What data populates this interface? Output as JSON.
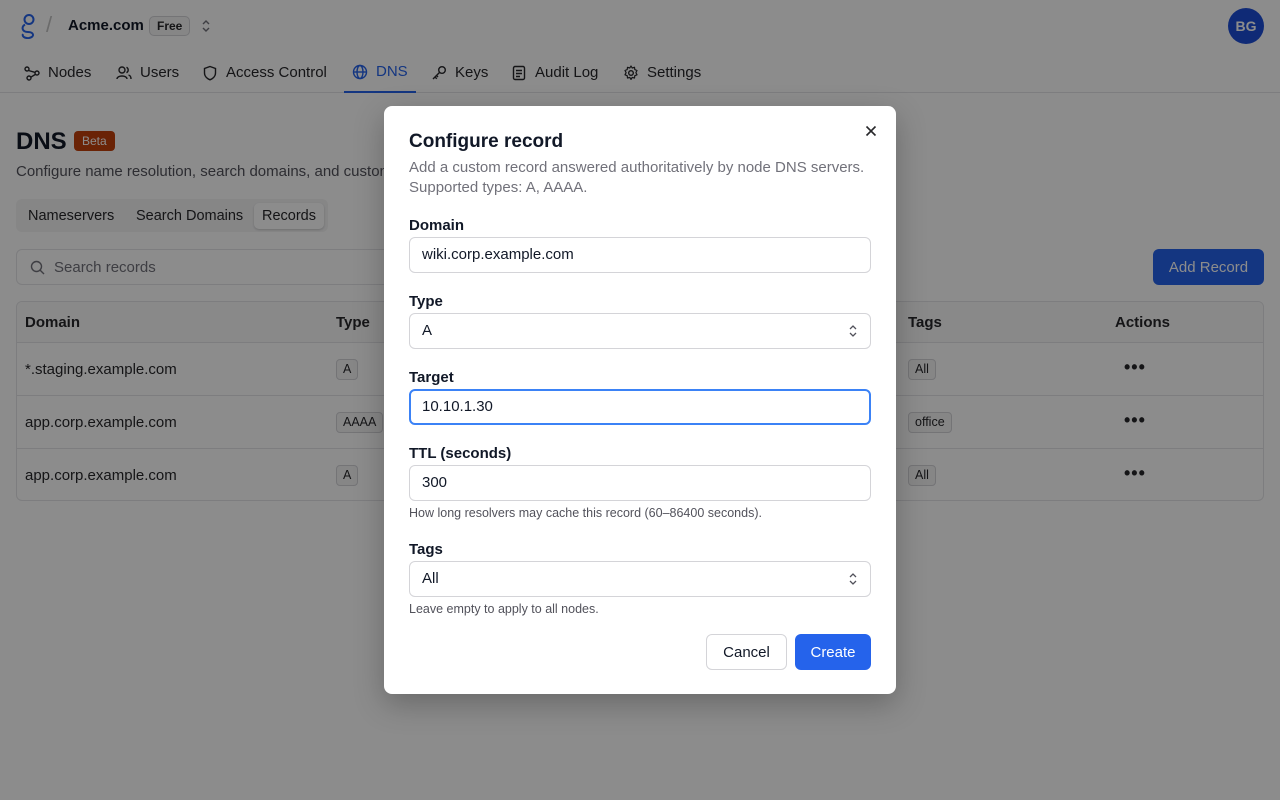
{
  "header": {
    "org_name": "Acme.com",
    "plan": "Free",
    "avatar_initials": "BG",
    "separator": "/"
  },
  "nav": {
    "items": [
      {
        "label": "Nodes",
        "icon": "nodes-icon"
      },
      {
        "label": "Users",
        "icon": "users-icon"
      },
      {
        "label": "Access Control",
        "icon": "shield-icon"
      },
      {
        "label": "DNS",
        "icon": "globe-icon",
        "active": true
      },
      {
        "label": "Keys",
        "icon": "key-icon"
      },
      {
        "label": "Audit Log",
        "icon": "document-icon"
      },
      {
        "label": "Settings",
        "icon": "gear-icon"
      }
    ]
  },
  "page": {
    "title": "DNS",
    "badge": "Beta",
    "subtitle": "Configure name resolution, search domains, and custom",
    "tabs": [
      "Nameservers",
      "Search Domains",
      "Records"
    ],
    "active_tab": "Records",
    "search_placeholder": "Search records",
    "add_button": "Add Record"
  },
  "table": {
    "columns": {
      "domain": "Domain",
      "type": "Type",
      "tags": "Tags",
      "actions": "Actions"
    },
    "rows": [
      {
        "domain": "*.staging.example.com",
        "type": "A",
        "tag": "All",
        "actions": "•••"
      },
      {
        "domain": "app.corp.example.com",
        "type": "AAAA",
        "tag": "office",
        "actions": "•••"
      },
      {
        "domain": "app.corp.example.com",
        "type": "A",
        "tag": "All",
        "actions": "•••"
      }
    ]
  },
  "modal": {
    "title": "Configure record",
    "description": "Add a custom record answered authoritatively by node DNS servers. Supported types: A, AAAA.",
    "domain_label": "Domain",
    "domain_value": "wiki.corp.example.com",
    "type_label": "Type",
    "type_value": "A",
    "target_label": "Target",
    "target_value": "10.10.1.30",
    "ttl_label": "TTL (seconds)",
    "ttl_value": "300",
    "ttl_hint": "How long resolvers may cache this record (60–86400 seconds).",
    "tags_label": "Tags",
    "tags_value": "All",
    "tags_hint": "Leave empty to apply to all nodes.",
    "cancel": "Cancel",
    "create": "Create"
  },
  "colors": {
    "accent": "#2563eb",
    "beta_badge": "#c2410c",
    "avatar": "#1d4ed8"
  }
}
